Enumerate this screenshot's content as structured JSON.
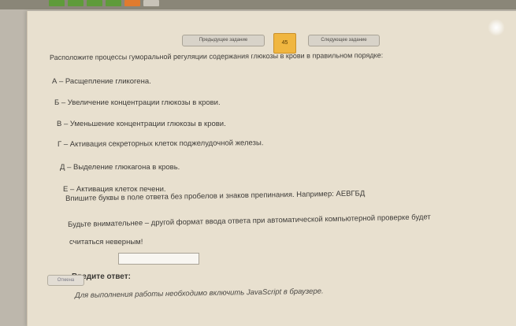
{
  "nav": {
    "prev_label": "Предыдущее задание",
    "page_number": "45",
    "next_label": "Следующее задание"
  },
  "task": {
    "question": "Расположите процессы гуморальной регуляции содержания глюкозы в крови в правильном порядке:",
    "options": [
      "А – Расщепление гликогена.",
      "Б – Увеличение концентрации глюкозы в крови.",
      "В – Уменьшение концентрации глюкозы в крови.",
      "Г – Активация секреторных клеток поджелудочной железы.",
      "Д – Выделение глюкагона в кровь.",
      "Е – Активация клеток печени."
    ],
    "instruction": "Впишите буквы в поле ответа без пробелов и знаков препинания. Например: АЕВГБД",
    "warning_line1": "Будьте внимательнее – другой формат ввода ответа при автоматической компьютерной проверке будет",
    "warning_line2": "считаться неверным!"
  },
  "answer": {
    "label": "Введите ответ:",
    "value": "",
    "cancel_label": "Отмена"
  },
  "footer": {
    "js_notice": "Для выполнения работы необходимо включить JavaScript в браузере."
  },
  "colors": {
    "panel_bg": "#e8e0cf",
    "page_badge": "#f0b640",
    "tab_green": "#5f9b3a",
    "tab_orange": "#e07b2e"
  }
}
